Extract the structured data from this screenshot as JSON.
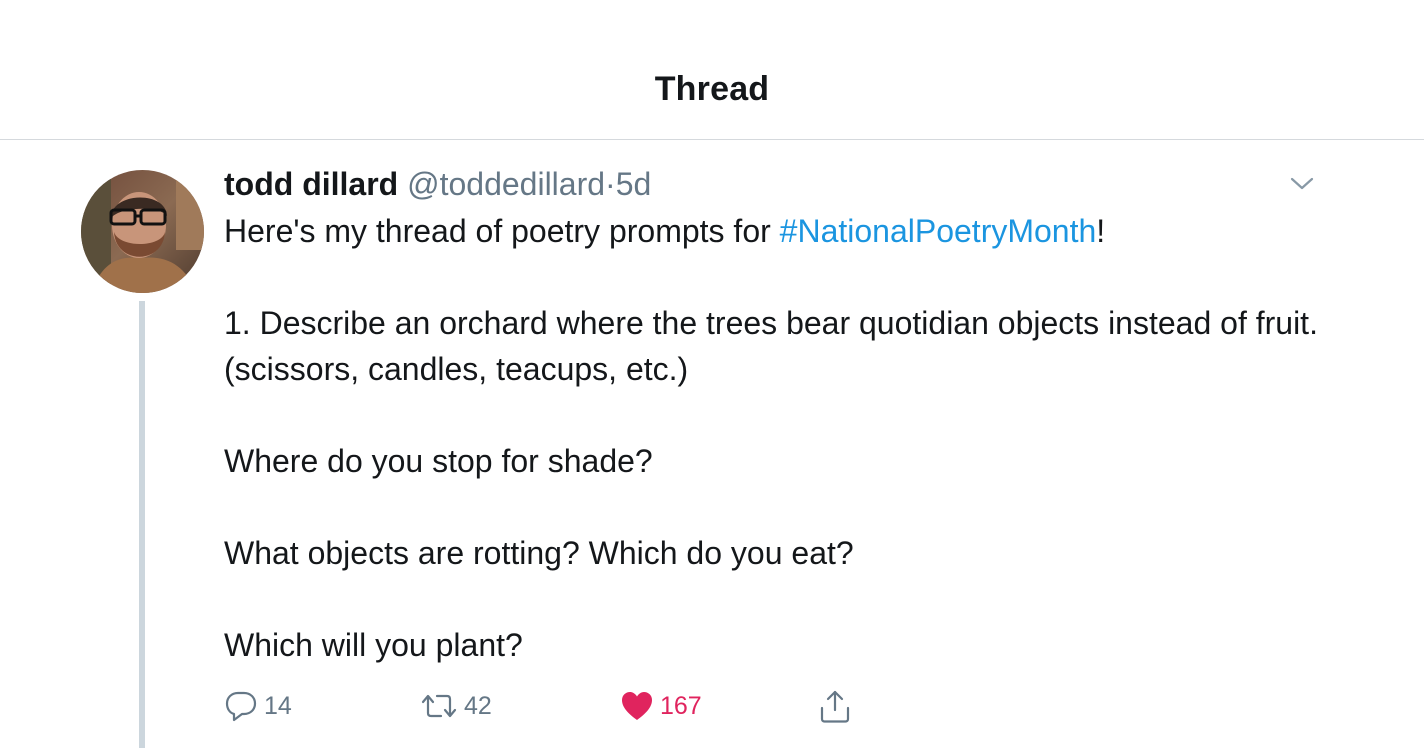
{
  "header": {
    "title": "Thread"
  },
  "tweet": {
    "display_name": "todd dillard",
    "handle": "@toddedillard",
    "separator": "·",
    "time": "5d",
    "text_intro": "Here's my thread of poetry prompts for ",
    "hashtag": "#NationalPoetryMonth",
    "text_intro_end": "!",
    "paragraph_1": "1. Describe an orchard where the trees bear quotidian objects instead of fruit. (scissors, candles, teacups, etc.)",
    "paragraph_2": "Where do you stop for shade?",
    "paragraph_3": "What objects are rotting? Which do you eat?",
    "paragraph_4": "Which will you plant?",
    "replies": "14",
    "retweets": "42",
    "likes": "167",
    "liked": true
  },
  "colors": {
    "link": "#1b95e0",
    "secondary_text": "#657786",
    "like_red": "#e0245e",
    "thread_line": "#ccd6dd"
  },
  "icons": {
    "menu": "chevron-down-icon",
    "reply": "reply-icon",
    "retweet": "retweet-icon",
    "like": "heart-icon",
    "share": "share-icon"
  }
}
